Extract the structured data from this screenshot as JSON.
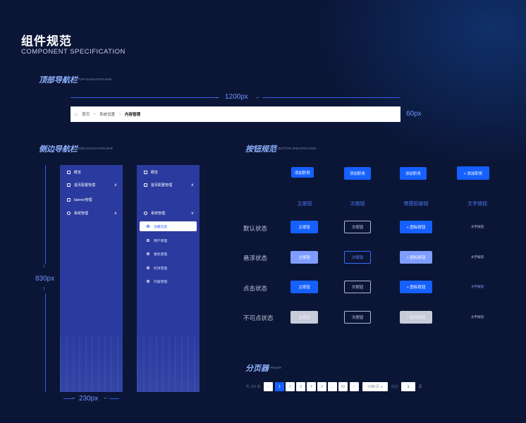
{
  "header": {
    "title": "组件规范",
    "subtitle": "COMPONENT SPECIFICATION"
  },
  "top_nav": {
    "heading": "顶部导航栏",
    "heading_en": "/ TOP NAVIGATION BAR",
    "width_label": "1200px",
    "height_label": "60px",
    "breadcrumb": [
      "首页",
      "系统设置",
      "内容管理"
    ]
  },
  "side_nav": {
    "heading": "侧边导航栏",
    "heading_en": "/ SIDE NAVIGATION BAR",
    "height_label": "830px",
    "width_label": "230px",
    "collapsed": {
      "items": [
        {
          "label": "概览",
          "icon": "monitor-icon",
          "chev": ""
        },
        {
          "label": "首页配置管理",
          "icon": "doc-icon",
          "chev": "∧"
        },
        {
          "label": "banner管理",
          "icon": "image-icon",
          "chev": ""
        },
        {
          "label": "系统管理",
          "icon": "gear-icon",
          "chev": "∧"
        }
      ]
    },
    "expanded": {
      "items": [
        {
          "label": "概览",
          "icon": "monitor-icon",
          "chev": ""
        },
        {
          "label": "首页配置管理",
          "icon": "doc-icon",
          "chev": "∧"
        },
        {
          "label": "系统管理",
          "icon": "gear-icon",
          "chev": "∨"
        }
      ],
      "sub_items": [
        "注册信息",
        "用户管理",
        "角色管理",
        "栏目管理",
        "内容管理"
      ],
      "active_sub": "注册信息"
    }
  },
  "buttons": {
    "heading": "按钮规范",
    "heading_en": "/ BUTTON SPECIFICATION",
    "sample_label": "添加职务",
    "icon_sample_label": "+ 添加职务",
    "columns": [
      "主按钮",
      "次按钮",
      "带图标按钮",
      "文字按钮"
    ],
    "rows": [
      "默认状态",
      "悬浮状态",
      "点击状态",
      "不可点状态"
    ],
    "primary_label": "主按钮",
    "secondary_label": "次按钮",
    "icon_label": "+ 图标按钮",
    "text_label": "文字按钮",
    "colors": {
      "primary": "#1560ff",
      "hover": "#7e9dff",
      "disabled": "#c7ccd9"
    }
  },
  "pager": {
    "heading": "分页器",
    "heading_en": "/ PAGER",
    "total": "共 100 条",
    "pages": [
      "‹",
      "1",
      "2",
      "3",
      "4",
      "5",
      "…",
      "50",
      "›"
    ],
    "active_page": "1",
    "page_size": "10条/页 ∨",
    "goto_label": "前往",
    "goto_value": "1",
    "page_suffix": "页"
  }
}
